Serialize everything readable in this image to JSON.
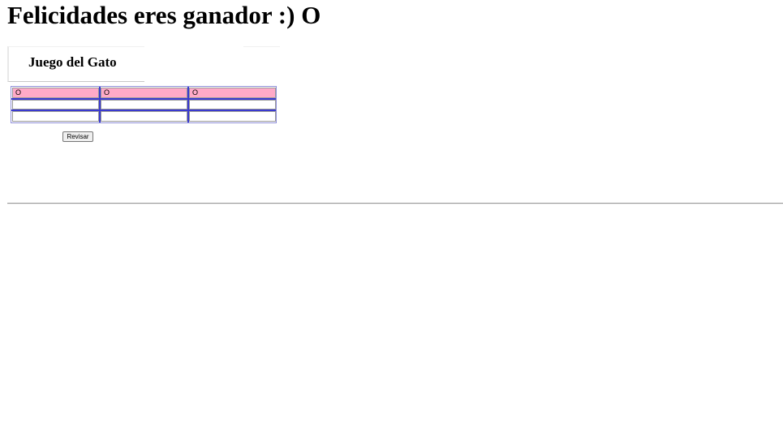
{
  "result": {
    "message": "Felicidades eres ganador :) O"
  },
  "game": {
    "title": "Juego del Gato",
    "board": [
      [
        "O",
        "O",
        "O"
      ],
      [
        "",
        "",
        ""
      ],
      [
        "",
        "",
        ""
      ]
    ],
    "winning_row": 0,
    "winning_color": "#ffaac8",
    "grid_color": "#3a3ad0",
    "check_button_label": "Revisar"
  }
}
